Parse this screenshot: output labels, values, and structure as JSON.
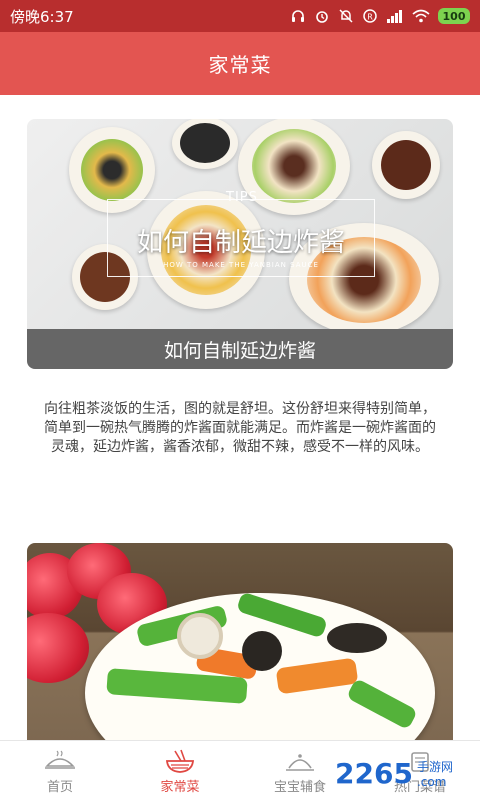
{
  "status_bar": {
    "time_text": "傍晚6:37",
    "battery_text": "100",
    "colors": {
      "background": "#b82e2e",
      "battery": "#7dd34f"
    }
  },
  "header": {
    "title": "家常菜",
    "colors": {
      "background": "#e35551"
    }
  },
  "articles": [
    {
      "image": {
        "overlay_tag": "TIPS",
        "overlay_title": "如何自制延边炸酱",
        "overlay_subtitle": "HOW TO MAKE THE YANBIAN SAUCE"
      },
      "caption": "如何自制延边炸酱",
      "description": "向往粗茶淡饭的生活，图的就是舒坦。这份舒坦来得特别简单，简单到一碗热气腾腾的炸酱面就能满足。而炸酱是一碗炸酱面的灵魂，延边炸酱，酱香浓郁，微甜不辣，感受不一样的风味。"
    },
    {
      "image": {}
    }
  ],
  "bottom_nav": {
    "items": [
      {
        "label": "首页",
        "icon": "dish-cover-icon",
        "active": false
      },
      {
        "label": "家常菜",
        "icon": "noodle-bowl-icon",
        "active": true
      },
      {
        "label": "宝宝辅食",
        "icon": "cloche-icon",
        "active": false
      },
      {
        "label": "热门菜谱",
        "icon": "recipe-book-icon",
        "active": false
      }
    ],
    "colors": {
      "active": "#e04842",
      "inactive": "#8a8a8a"
    }
  },
  "watermark": {
    "number": "2265",
    "suffix": "手游网",
    "domain": ".com"
  }
}
